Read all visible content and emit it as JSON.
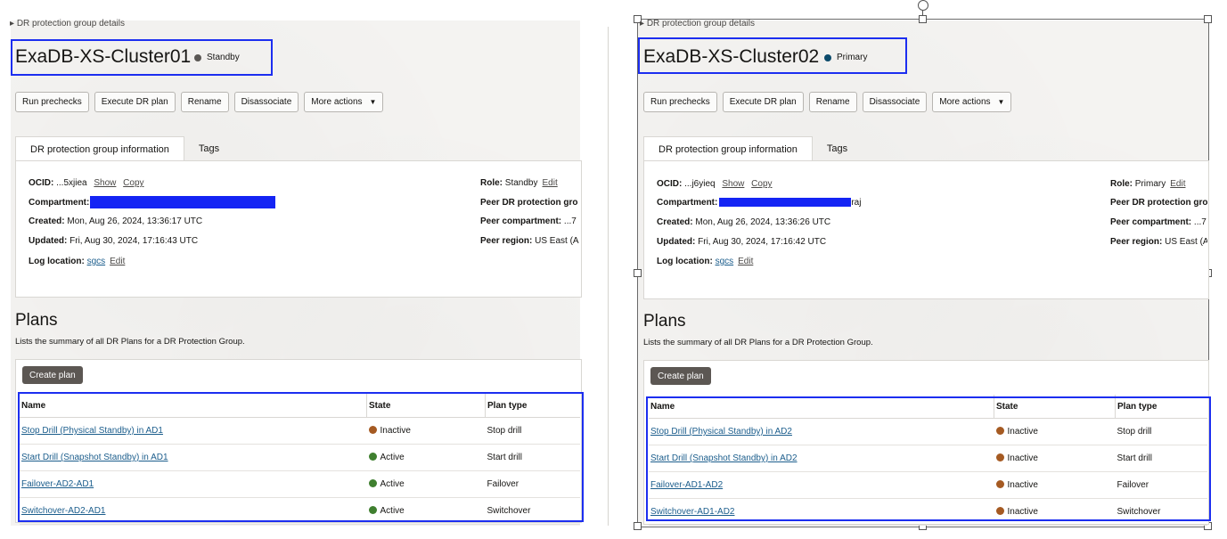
{
  "breadcrumb": "DR protection group details",
  "colors": {
    "standby": "#5a5754",
    "primary": "#0b4a6b",
    "active": "#3f7f2f",
    "inactive": "#a55a22",
    "highlight": "#1c2ef0"
  },
  "buttons": [
    "Run prechecks",
    "Execute DR plan",
    "Rename",
    "Disassociate",
    "More actions"
  ],
  "tabs": [
    "DR protection group information",
    "Tags"
  ],
  "plans": {
    "heading": "Plans",
    "description": "Lists the summary of all DR Plans for a DR Protection Group.",
    "create_label": "Create plan",
    "columns": [
      "Name",
      "State",
      "Plan type"
    ]
  },
  "labels": {
    "ocid": "OCID:",
    "compartment": "Compartment:",
    "created": "Created:",
    "updated": "Updated:",
    "log": "Log location:",
    "role": "Role:",
    "peer_group": "Peer DR protection gro",
    "peer_compartment": "Peer compartment:",
    "peer_region": "Peer region:",
    "show": "Show",
    "copy": "Copy",
    "edit": "Edit"
  },
  "left": {
    "title": "ExaDB-XS-Cluster01",
    "status": "Standby",
    "ocid": "...5xjiea",
    "created": "Mon, Aug 26, 2024, 13:36:17 UTC",
    "updated": "Fri, Aug 30, 2024, 17:16:43 UTC",
    "log": "sgcs",
    "role": "Standby",
    "peer_compartment": "...7",
    "peer_region": "US East (A",
    "rows": [
      {
        "name": "Stop Drill (Physical Standby) in AD1",
        "state": "Inactive",
        "type": "Stop drill"
      },
      {
        "name": "Start Drill (Snapshot Standby) in AD1",
        "state": "Active",
        "type": "Start drill"
      },
      {
        "name": "Failover-AD2-AD1",
        "state": "Active",
        "type": "Failover"
      },
      {
        "name": "Switchover-AD2-AD1",
        "state": "Active",
        "type": "Switchover"
      }
    ]
  },
  "right": {
    "title": "ExaDB-XS-Cluster02",
    "status": "Primary",
    "ocid": "...j6yieq",
    "compartment_suffix": "raj",
    "created": "Mon, Aug 26, 2024, 13:36:26 UTC",
    "updated": "Fri, Aug 30, 2024, 17:16:42 UTC",
    "log": "sgcs",
    "role": "Primary",
    "peer_compartment": "...7",
    "peer_region": "US East (A",
    "rows": [
      {
        "name": "Stop Drill (Physical Standby) in AD2",
        "state": "Inactive",
        "type": "Stop drill"
      },
      {
        "name": "Start Drill (Snapshot Standby) in AD2",
        "state": "Inactive",
        "type": "Start drill"
      },
      {
        "name": "Failover-AD1-AD2",
        "state": "Inactive",
        "type": "Failover"
      },
      {
        "name": "Switchover-AD1-AD2",
        "state": "Inactive",
        "type": "Switchover"
      }
    ]
  }
}
